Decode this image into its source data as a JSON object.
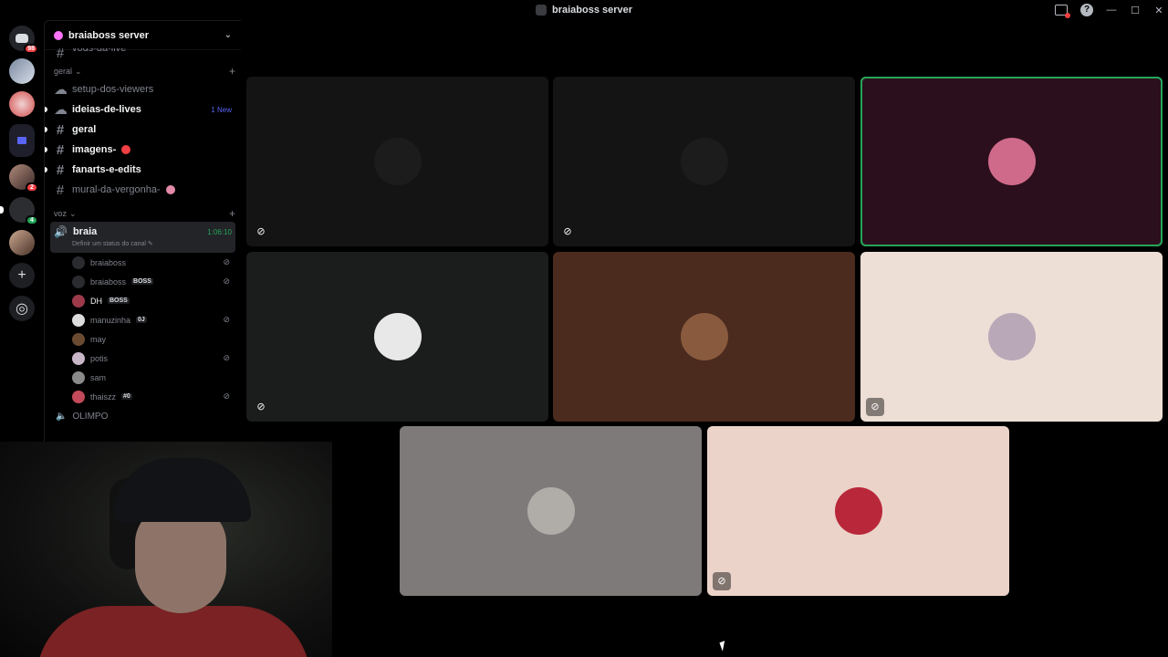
{
  "window": {
    "title": "braiaboss server"
  },
  "rail": {
    "home_badge": "98",
    "server2_badge": "2",
    "server3_badge": "4"
  },
  "sidebar": {
    "server_name": "braiaboss server",
    "partial_channel": "vods-da-live",
    "category_geral": "geral",
    "channels": [
      {
        "name": "setup-dos-viewers",
        "type": "forum",
        "unread": false
      },
      {
        "name": "ideias-de-lives",
        "type": "forum",
        "unread": true,
        "tag": "1 New"
      },
      {
        "name": "geral",
        "type": "text",
        "unread": true
      },
      {
        "name": "imagens-",
        "type": "text",
        "unread": true
      },
      {
        "name": "fanarts-e-edits",
        "type": "text",
        "unread": true
      },
      {
        "name": "mural-da-vergonha-",
        "type": "text",
        "unread": false
      }
    ],
    "category_voz": "voz",
    "voice_channel": {
      "name": "braia",
      "timer": "1:06:10",
      "status": "Definir um status do canal"
    },
    "voice_users": [
      {
        "name": "braiaboss",
        "tag": "",
        "muted": true,
        "active": false,
        "color": "#2a2b2e"
      },
      {
        "name": "braiaboss",
        "tag": "BOSS",
        "muted": true,
        "active": false,
        "color": "#2a2b2e"
      },
      {
        "name": "DH",
        "tag": "BOSS",
        "muted": false,
        "active": true,
        "color": "#9c3a4a"
      },
      {
        "name": "manuzinha",
        "tag": "0J",
        "muted": true,
        "active": false,
        "color": "#dcdcdc"
      },
      {
        "name": "may",
        "tag": "",
        "muted": false,
        "active": false,
        "color": "#6b4a32"
      },
      {
        "name": "potis",
        "tag": "",
        "muted": true,
        "active": false,
        "color": "#c8b6c8"
      },
      {
        "name": "sam",
        "tag": "",
        "muted": false,
        "active": false,
        "color": "#8a8a8a"
      },
      {
        "name": "thaiszz",
        "tag": "#0",
        "muted": true,
        "active": false,
        "color": "#c24a5a"
      }
    ],
    "next_channel": "OLIMPO"
  },
  "stage": {
    "tiles": [
      {
        "bg": "#141414",
        "avatar": "#1c1c1c",
        "muted": true,
        "speaking": false
      },
      {
        "bg": "#141414",
        "avatar": "#1c1c1c",
        "muted": true,
        "speaking": false
      },
      {
        "bg": "#2c0f1c",
        "avatar": "#d06a8a",
        "muted": false,
        "speaking": true
      },
      {
        "bg": "#1b1c1c",
        "avatar": "#e8e8e8",
        "muted": true,
        "speaking": false
      },
      {
        "bg": "#4a2b1e",
        "avatar": "#8a5a3e",
        "muted": false,
        "speaking": false
      },
      {
        "bg": "#eddfd6",
        "avatar": "#b9a8b8",
        "muted": true,
        "speaking": false
      },
      {
        "bg": "#7d7a79",
        "avatar": "#b0aca8",
        "muted": false,
        "speaking": false
      },
      {
        "bg": "#ebd3c9",
        "avatar": "#b8283a",
        "muted": true,
        "speaking": false
      }
    ]
  }
}
